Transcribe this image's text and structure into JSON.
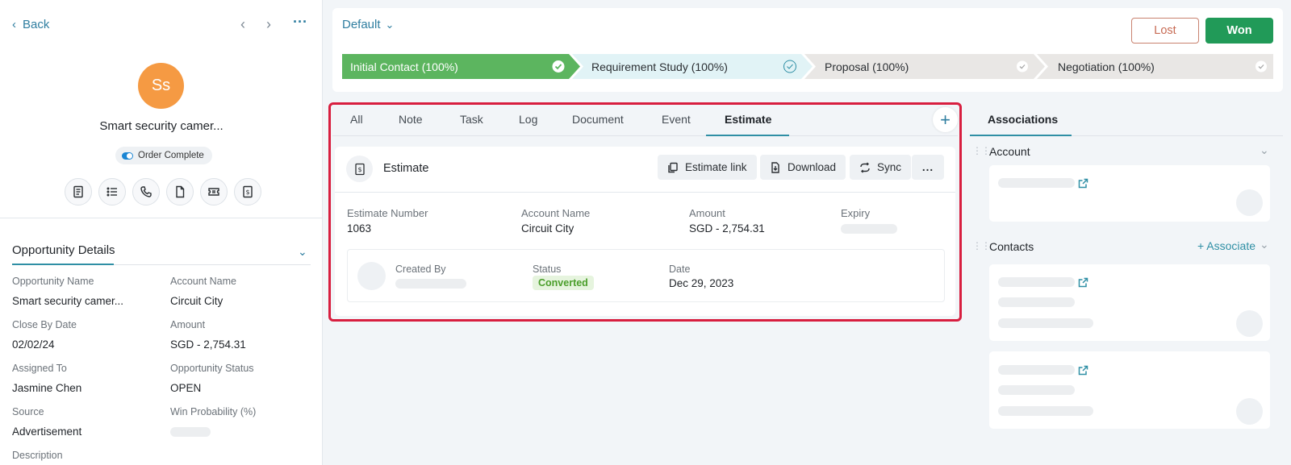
{
  "header": {
    "back_label": "Back",
    "avatar_initials": "Ss",
    "opportunity_name": "Smart security camer...",
    "status_badge": "Order Complete"
  },
  "details": {
    "title": "Opportunity Details",
    "fields": [
      {
        "label": "Opportunity Name",
        "value": "Smart security camer..."
      },
      {
        "label": "Account Name",
        "value": "Circuit City"
      },
      {
        "label": "Close By Date",
        "value": "02/02/24"
      },
      {
        "label": "Amount",
        "value": "SGD - 2,754.31"
      },
      {
        "label": "Assigned To",
        "value": "Jasmine Chen"
      },
      {
        "label": "Opportunity Status",
        "value": "OPEN"
      },
      {
        "label": "Source",
        "value": "Advertisement"
      },
      {
        "label": "Win Probability (%)",
        "value": ""
      },
      {
        "label": "Description",
        "value": ""
      }
    ]
  },
  "pipeline": {
    "name": "Default",
    "lost_label": "Lost",
    "won_label": "Won",
    "stages": [
      {
        "label": "Initial Contact (100%)",
        "state": "active"
      },
      {
        "label": "Requirement Study (100%)",
        "state": "current"
      },
      {
        "label": "Proposal (100%)",
        "state": "done"
      },
      {
        "label": "Negotiation (100%)",
        "state": "done"
      }
    ]
  },
  "tabs": [
    "All",
    "Note",
    "Task",
    "Log",
    "Document",
    "Event",
    "Estimate"
  ],
  "active_tab": "Estimate",
  "estimate": {
    "title": "Estimate",
    "link_label": "Estimate link",
    "download_label": "Download",
    "sync_label": "Sync",
    "more_label": "...",
    "number_label": "Estimate Number",
    "number_value": "1063",
    "account_label": "Account Name",
    "account_value": "Circuit City",
    "amount_label": "Amount",
    "amount_value": "SGD - 2,754.31",
    "expiry_label": "Expiry",
    "created_by_label": "Created By",
    "status_label": "Status",
    "status_value": "Converted",
    "date_label": "Date",
    "date_value": "Dec 29, 2023"
  },
  "associations": {
    "title": "Associations",
    "account_section": "Account",
    "contacts_section": "Contacts",
    "associate_label": "+ Associate"
  },
  "colors": {
    "accent": "#2f8fa5",
    "stage_active": "#5cb55f",
    "stage_current": "#e1f3f6",
    "stage_done": "#e9e7e5",
    "won": "#219a58",
    "lost": "#c76b54",
    "highlight": "#d81e3f"
  }
}
